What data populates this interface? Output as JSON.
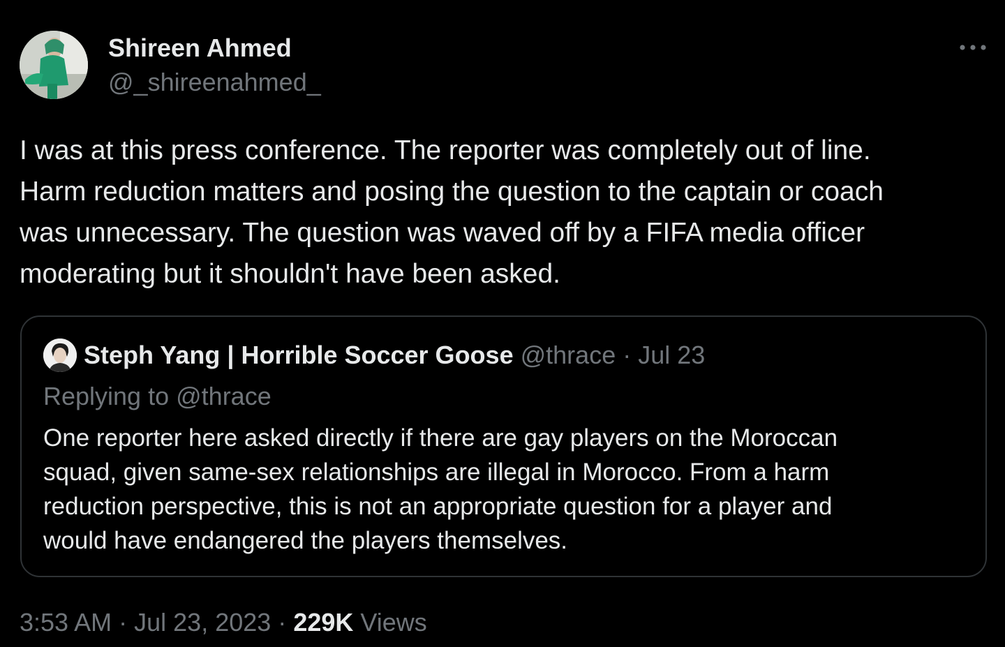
{
  "author": {
    "name": "Shireen Ahmed",
    "handle": "@_shireenahmed_",
    "avatar_icon": "profile-photo"
  },
  "more_icon": "ellipsis-horizontal-icon",
  "tweet": {
    "lines": [
      "I was at this press conference. The reporter was completely out of line.",
      "Harm reduction matters and posing the question to the captain or coach",
      "was unnecessary. The question was waved off by a FIFA media officer",
      "moderating but it shouldn't have been asked."
    ]
  },
  "quote": {
    "name": "Steph Yang | Horrible Soccer Goose",
    "handle": "@thrace",
    "separator": "·",
    "date": "Jul 23",
    "replying_prefix": "Replying to",
    "replying_handle": "@thrace",
    "lines": [
      "One reporter here asked directly if there are gay players on the Moroccan",
      "squad, given same-sex relationships are illegal in Morocco. From a harm",
      "reduction perspective, this is not an appropriate question for a player and",
      "would have endangered the players themselves."
    ]
  },
  "meta": {
    "time": "3:53 AM",
    "separator": "·",
    "date": "Jul 23, 2023",
    "views_count": "229K",
    "views_label": "Views"
  },
  "colors": {
    "background": "#000000",
    "primary_text": "#e7e9ea",
    "secondary_text": "#71767b",
    "border": "#2f3336"
  }
}
